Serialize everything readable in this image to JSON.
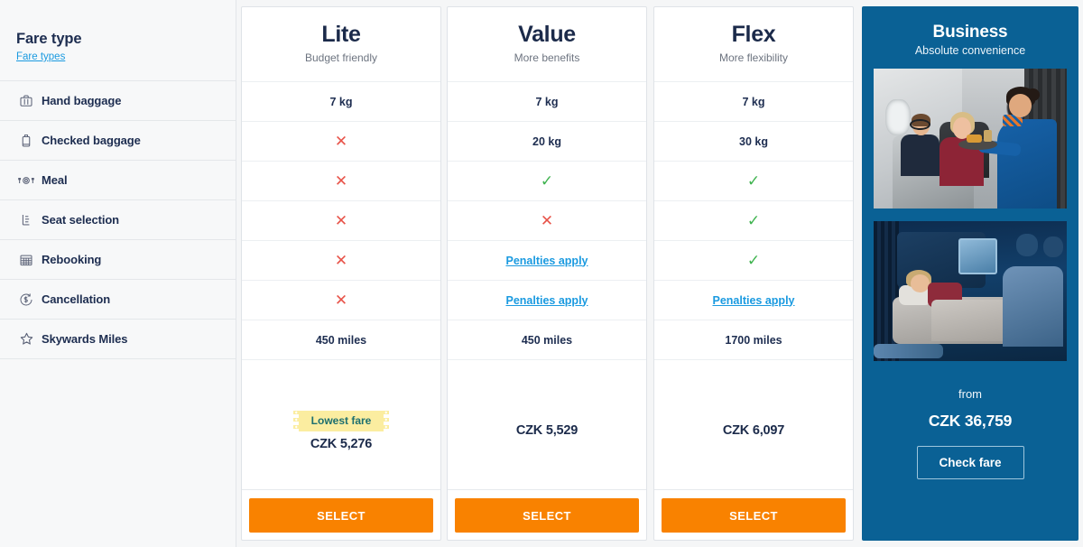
{
  "sidebar": {
    "title": "Fare type",
    "link_label": "Fare types",
    "features": [
      {
        "label": "Hand baggage",
        "icon": "hand-baggage-icon"
      },
      {
        "label": "Checked baggage",
        "icon": "checked-baggage-icon"
      },
      {
        "label": "Meal",
        "icon": "meal-icon"
      },
      {
        "label": "Seat selection",
        "icon": "seat-selection-icon"
      },
      {
        "label": "Rebooking",
        "icon": "rebooking-calendar-icon"
      },
      {
        "label": "Cancellation",
        "icon": "cancellation-refund-icon"
      },
      {
        "label": "Skywards Miles",
        "icon": "star-icon"
      }
    ]
  },
  "fares": [
    {
      "name": "Lite",
      "tagline": "Budget friendly",
      "cells": [
        {
          "kind": "text",
          "value": "7 kg"
        },
        {
          "kind": "cross",
          "value": "✕"
        },
        {
          "kind": "cross",
          "value": "✕"
        },
        {
          "kind": "cross",
          "value": "✕"
        },
        {
          "kind": "cross",
          "value": "✕"
        },
        {
          "kind": "cross",
          "value": "✕"
        },
        {
          "kind": "text",
          "value": "450 miles"
        }
      ],
      "badge": "Lowest fare",
      "price": "CZK 5,276",
      "select_label": "SELECT"
    },
    {
      "name": "Value",
      "tagline": "More benefits",
      "cells": [
        {
          "kind": "text",
          "value": "7 kg"
        },
        {
          "kind": "text",
          "value": "20 kg"
        },
        {
          "kind": "tick",
          "value": "✓"
        },
        {
          "kind": "cross",
          "value": "✕"
        },
        {
          "kind": "penalty",
          "value": "Penalties apply"
        },
        {
          "kind": "penalty",
          "value": "Penalties apply"
        },
        {
          "kind": "text",
          "value": "450 miles"
        }
      ],
      "badge": null,
      "price": "CZK 5,529",
      "select_label": "SELECT"
    },
    {
      "name": "Flex",
      "tagline": "More flexibility",
      "cells": [
        {
          "kind": "text",
          "value": "7 kg"
        },
        {
          "kind": "text",
          "value": "30 kg"
        },
        {
          "kind": "tick",
          "value": "✓"
        },
        {
          "kind": "tick",
          "value": "✓"
        },
        {
          "kind": "tick",
          "value": "✓"
        },
        {
          "kind": "penalty",
          "value": "Penalties apply"
        },
        {
          "kind": "text",
          "value": "1700 miles"
        }
      ],
      "badge": null,
      "price": "CZK 6,097",
      "select_label": "SELECT"
    }
  ],
  "business": {
    "name": "Business",
    "tagline": "Absolute convenience",
    "photo_1_alt": "cabin-crew-serving-meal-photo",
    "photo_2_alt": "lie-flat-bed-passenger-sleeping-photo",
    "from_label": "from",
    "price": "CZK 36,759",
    "button_label": "Check fare"
  },
  "colors": {
    "page_bg": "#f5f6f7",
    "sidebar_bg": "#f7f8f9",
    "card_bg": "#ffffff",
    "card_border": "#dfe3e8",
    "text_navy": "#1d2d50",
    "link_blue": "#1a9ae0",
    "cross_red": "#e8544a",
    "tick_green": "#3fb34f",
    "select_orange": "#f98200",
    "badge_yellow": "#fbeda0",
    "badge_text": "#1d6f6f",
    "business_blue": "#0a6195"
  }
}
